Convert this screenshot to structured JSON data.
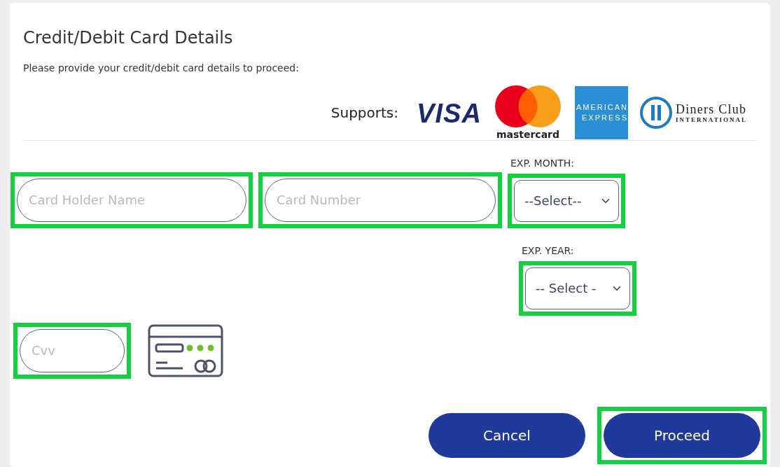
{
  "dialog": {
    "title": "Credit/Debit Card Details",
    "instruction": "Please provide your credit/debit card details to proceed:"
  },
  "supports": {
    "label": "Supports:",
    "logos": [
      {
        "kind": "visa",
        "lines": [
          "VISA"
        ]
      },
      {
        "kind": "mastercard",
        "lines": [
          "mastercard"
        ]
      },
      {
        "kind": "amex",
        "lines": [
          "AMERICAN",
          "EXPRESS"
        ]
      },
      {
        "kind": "diners",
        "lines": [
          "Diners Club",
          "INTERNATIONAL"
        ]
      }
    ]
  },
  "fields": [
    {
      "kind": "text",
      "placeholder": "Card Holder Name",
      "highlighted": true
    },
    {
      "kind": "text",
      "placeholder": "Card Number",
      "highlighted": true
    },
    {
      "kind": "select",
      "label": "EXP. MONTH:",
      "value": "--Select--",
      "highlighted": true
    },
    {
      "kind": "select",
      "label": "EXP. YEAR:",
      "value": "-- Select -",
      "highlighted": true
    },
    {
      "kind": "text",
      "placeholder": "Cvv",
      "highlighted": true
    }
  ],
  "buttons": [
    {
      "label": "Cancel",
      "highlighted": false
    },
    {
      "label": "Proceed",
      "highlighted": true
    }
  ]
}
